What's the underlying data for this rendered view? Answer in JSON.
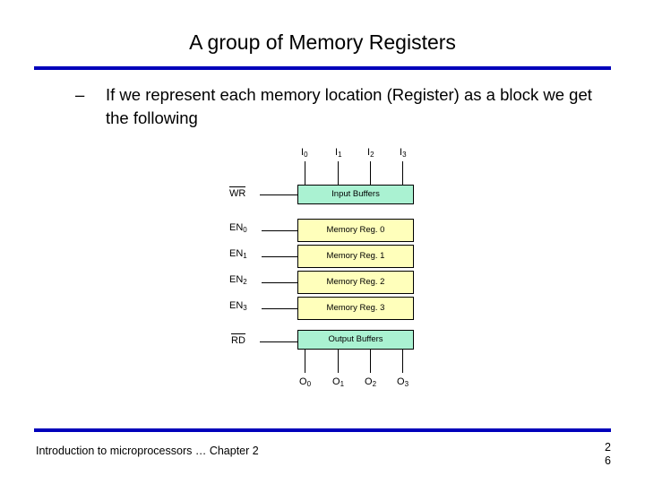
{
  "slide": {
    "title": "A group of Memory Registers",
    "bullet": {
      "marker": "–",
      "text": "If we represent each memory location (Register) as a block we get the following"
    },
    "footer": {
      "left": "Introduction to microprocessors … Chapter 2",
      "page_line1": "2",
      "page_line2": "6"
    }
  },
  "diagram": {
    "inputs": [
      {
        "label": "I",
        "sub": "0"
      },
      {
        "label": "I",
        "sub": "1"
      },
      {
        "label": "I",
        "sub": "2"
      },
      {
        "label": "I",
        "sub": "3"
      }
    ],
    "outputs": [
      {
        "label": "O",
        "sub": "0"
      },
      {
        "label": "O",
        "sub": "1"
      },
      {
        "label": "O",
        "sub": "2"
      },
      {
        "label": "O",
        "sub": "3"
      }
    ],
    "controls": [
      {
        "label": "WR",
        "sub": "",
        "overline": true
      },
      {
        "label": "EN",
        "sub": "0",
        "overline": false
      },
      {
        "label": "EN",
        "sub": "1",
        "overline": false
      },
      {
        "label": "EN",
        "sub": "2",
        "overline": false
      },
      {
        "label": "EN",
        "sub": "3",
        "overline": false
      },
      {
        "label": "RD",
        "sub": "",
        "overline": true
      }
    ],
    "blocks": [
      {
        "label": "Input Buffers",
        "color": "#aaf2d2"
      },
      {
        "label": "Memory Reg. 0",
        "color": "#ffffbb"
      },
      {
        "label": "Memory Reg. 1",
        "color": "#ffffbb"
      },
      {
        "label": "Memory Reg. 2",
        "color": "#ffffbb"
      },
      {
        "label": "Memory Reg. 3",
        "color": "#ffffbb"
      },
      {
        "label": "Output Buffers",
        "color": "#aaf2d2"
      }
    ]
  }
}
